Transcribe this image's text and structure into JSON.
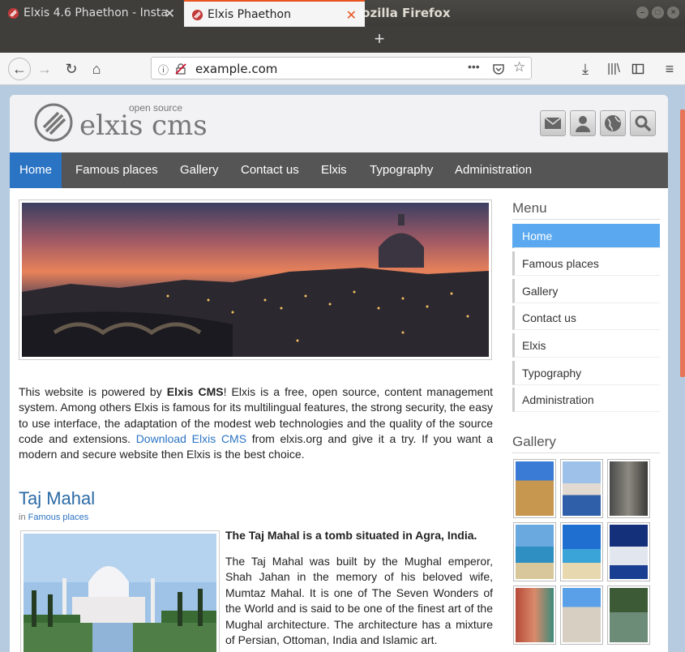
{
  "window": {
    "title": "Elxis Phaethon - Mozilla Firefox"
  },
  "tabs": [
    {
      "label": "Elxis 4.6 Phaethon - Insta",
      "active": false
    },
    {
      "label": "Elxis Phaethon",
      "active": true
    }
  ],
  "nav": {
    "url": "example.com",
    "page_actions": "•••"
  },
  "site": {
    "logo": {
      "main": "elxis",
      "cms": "cms",
      "tagline": "open source"
    },
    "menu": [
      "Home",
      "Famous places",
      "Gallery",
      "Contact us",
      "Elxis",
      "Typography",
      "Administration"
    ],
    "active_menu": "Home",
    "intro": {
      "prefix": "This website is powered by ",
      "bold": "Elxis CMS",
      "middle": "! Elxis is a free, open source, content management system. Among others Elxis is famous for its multilingual features, the strong security, the easy to use interface, the adaptation of the modest web technologies and the quality of the source code and extensions. ",
      "link": "Download Elxis CMS",
      "suffix": " from elxis.org and give it a try. If you want a modern and secure website then Elxis is the best choice."
    },
    "article": {
      "title": "Taj Mahal",
      "category_prefix": "in ",
      "category": "Famous places",
      "lead": "The Taj Mahal is a tomb situated in Agra, India.",
      "body": "The Taj Mahal was built by the Mughal emperor, Shah Jahan in the memory of his beloved wife, Mumtaz Mahal. It is one of The Seven Wonders of the World and is said to be one of the finest art of the Mughal architecture. The architecture has a mixture of Persian, Ottoman, India and Islamic art."
    },
    "sidebar": {
      "menu_heading": "Menu",
      "menu_items": [
        "Home",
        "Famous places",
        "Gallery",
        "Contact us",
        "Elxis",
        "Typography",
        "Administration"
      ],
      "gallery_heading": "Gallery"
    }
  },
  "colors": {
    "accent": "#2b74c4",
    "menubar": "#555555",
    "side_active": "#5aa9f0",
    "tab_highlight": "#e95420"
  }
}
